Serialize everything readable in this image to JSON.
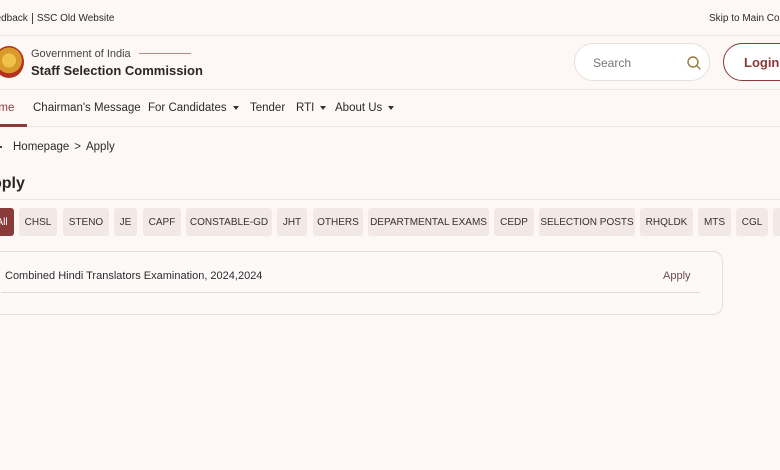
{
  "topbar": {
    "feedback": "eedback",
    "old_website": "SSC Old Website",
    "skip": "Skip to Main Cont"
  },
  "header": {
    "government": "Government of India",
    "commission": "Staff Selection Commission",
    "search_placeholder": "Search",
    "login_label": "Login"
  },
  "nav": [
    {
      "label": "ome",
      "dropdown": false,
      "active": true
    },
    {
      "label": "Chairman's Message",
      "dropdown": false
    },
    {
      "label": "For Candidates",
      "dropdown": true
    },
    {
      "label": "Tender",
      "dropdown": false
    },
    {
      "label": "RTI",
      "dropdown": true
    },
    {
      "label": "About Us",
      "dropdown": true
    }
  ],
  "breadcrumb": {
    "home": "Homepage",
    "separator": ">",
    "current": "Apply"
  },
  "page_title": "pply",
  "tabs": [
    "All",
    "CHSL",
    "STENO",
    "JE",
    "CAPF",
    "CONSTABLE-GD",
    "JHT",
    "OTHERS",
    "DEPARTMENTAL EXAMS",
    "CEDP",
    "SELECTION POSTS",
    "RHQLDK",
    "MTS",
    "CGL",
    ""
  ],
  "notices": [
    {
      "name": "Combined Hindi Translators Examination, 2024,2024",
      "action": "Apply"
    }
  ],
  "icons": {
    "search": "search-icon",
    "emblem": "emblem-icon"
  },
  "colors": {
    "brand": "#8b3a3a",
    "background": "#fdf8f6",
    "chip": "#f2e8e5"
  }
}
